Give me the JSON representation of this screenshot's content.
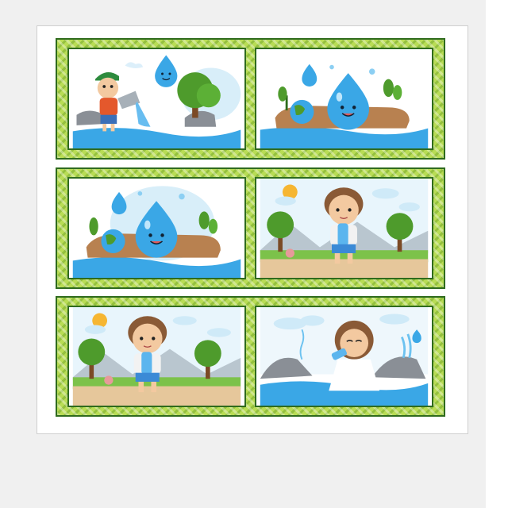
{
  "colors": {
    "band_green": "#b8dc55",
    "border_dark_green": "#2f6b1d",
    "water_blue": "#3aa7e6",
    "sky_blue": "#cfeaf8",
    "tree_green": "#4e9b2c",
    "earth_brown": "#b88150"
  },
  "cards": [
    {
      "id": "card-1",
      "icons": [
        "water-drop-icon",
        "boy-pouring-bucket-icon",
        "rock-icon",
        "tree-icon"
      ]
    },
    {
      "id": "card-2",
      "icons": [
        "water-drop-icon",
        "smiling-water-drop-icon",
        "earth-globe-icon",
        "plant-icon"
      ]
    },
    {
      "id": "card-3",
      "icons": [
        "water-drop-icon",
        "smiling-water-drop-icon",
        "earth-globe-icon",
        "plant-icon"
      ]
    },
    {
      "id": "card-4",
      "icons": [
        "sun-icon",
        "cloud-icon",
        "boy-holding-bottle-icon",
        "tree-icon"
      ]
    },
    {
      "id": "card-5",
      "icons": [
        "sun-icon",
        "cloud-icon",
        "boy-holding-bottle-icon",
        "tree-icon"
      ]
    },
    {
      "id": "card-6",
      "icons": [
        "cloud-icon",
        "girl-drinking-water-icon",
        "waterfall-icon",
        "rock-icon"
      ]
    }
  ]
}
